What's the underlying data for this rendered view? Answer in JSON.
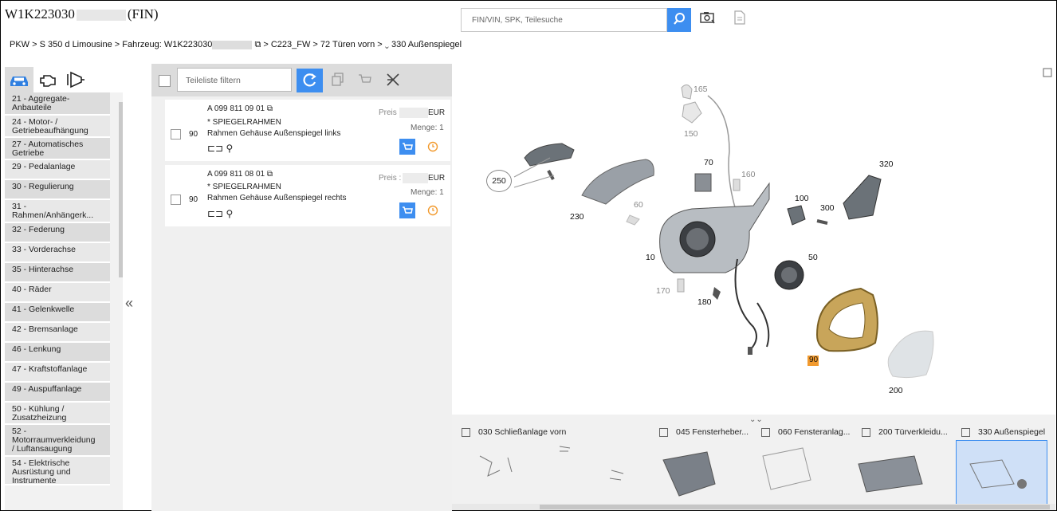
{
  "header": {
    "vin_prefix": "W1K223030",
    "vin_suffix": "(FIN)",
    "search_placeholder": "FIN/VIN, SPK, Teilesuche"
  },
  "breadcrumb": {
    "part1": "PKW > S 350 d Limousine > Fahrzeug: W1K223030",
    "part2": "> C223_FW",
    "part3": "> 72 Türen vorn >",
    "part4": "330 Außenspiegel"
  },
  "categories": [
    {
      "label": "21 - Aggregate-\nAnbauteile"
    },
    {
      "label": "24 - Motor- /\nGetriebeaufhängung"
    },
    {
      "label": "27 - Automatisches\nGetriebe"
    },
    {
      "label": "29 - Pedalanlage"
    },
    {
      "label": "30 - Regulierung"
    },
    {
      "label": "31 -\nRahmen/Anhängerk..."
    },
    {
      "label": "32 - Federung"
    },
    {
      "label": "33 - Vorderachse"
    },
    {
      "label": "35 - Hinterachse"
    },
    {
      "label": "40 - Räder"
    },
    {
      "label": "41 - Gelenkwelle"
    },
    {
      "label": "42 - Bremsanlage"
    },
    {
      "label": "46 - Lenkung"
    },
    {
      "label": "47 - Kraftstoffanlage"
    },
    {
      "label": "49 - Auspuffanlage"
    },
    {
      "label": "50 - Kühlung /\nZusatzheizung"
    },
    {
      "label": "52 -\nMotorraumverkleidung\n/ Luftansaugung"
    },
    {
      "label": "54 - Elektrische\nAusrüstung und\nInstrumente"
    }
  ],
  "filter": {
    "placeholder": "Teileliste filtern"
  },
  "parts": [
    {
      "part_number": "A 099 811 09 01",
      "position": "90",
      "name": "* SPIEGELRAHMEN",
      "description": "Rahmen Gehäuse Außenspiegel links",
      "price_label": "Preis",
      "currency": "EUR",
      "qty_label": "Menge: 1"
    },
    {
      "part_number": "A 099 811 08 01",
      "position": "90",
      "name": "* SPIEGELRAHMEN",
      "description": "Rahmen Gehäuse Außenspiegel rechts",
      "price_label": "Preis :",
      "currency": "EUR",
      "qty_label": "Menge: 1"
    }
  ],
  "diagram_labels": {
    "n165": "165",
    "n150": "150",
    "n70": "70",
    "n160": "160",
    "n320": "320",
    "n250": "250",
    "n60": "60",
    "n230": "230",
    "n100": "100",
    "n300": "300",
    "n10": "10",
    "n50": "50",
    "n170": "170",
    "n180": "180",
    "n90": "90",
    "n200": "200"
  },
  "thumb_tabs": [
    {
      "label": "030 Schließanlage vorn"
    },
    {
      "label": "045 Fensterheber..."
    },
    {
      "label": "060 Fensteranlag..."
    },
    {
      "label": "200 Türverkleidu..."
    },
    {
      "label": "330 Außenspiegel"
    }
  ],
  "colors": {
    "accent": "#3d8ef0",
    "highlight": "#f29a2e"
  }
}
